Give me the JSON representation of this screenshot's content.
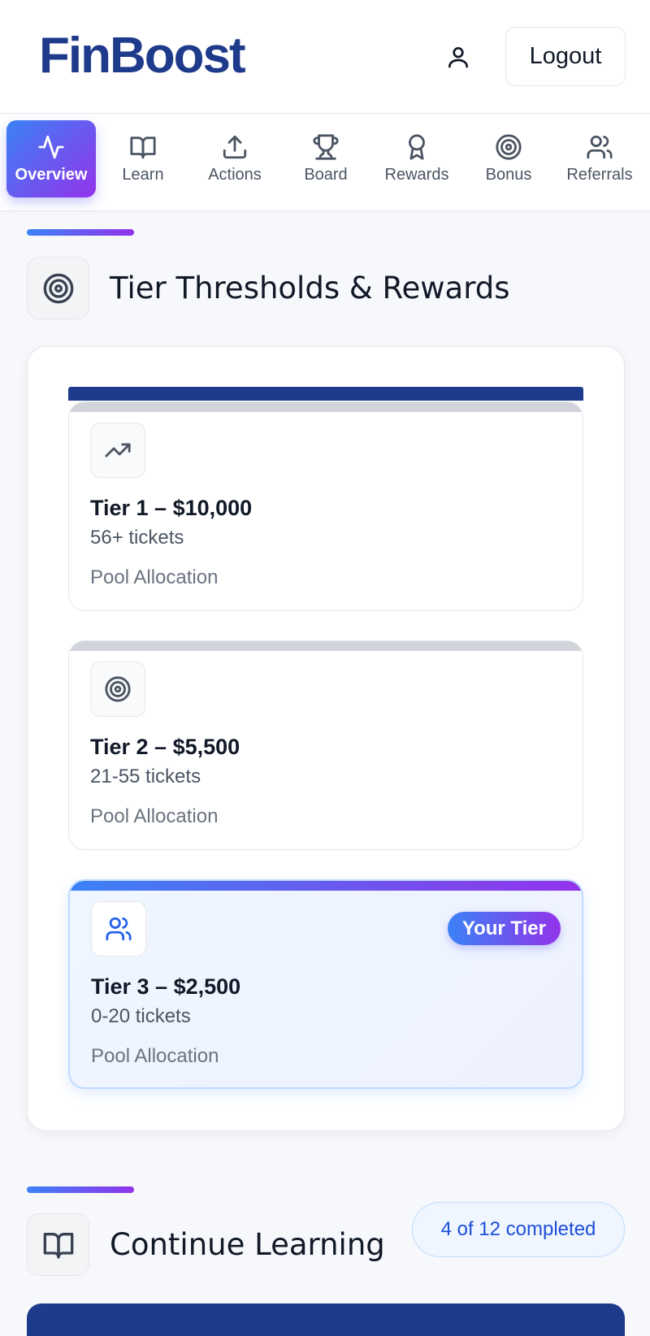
{
  "app": {
    "brand": "FinBoost",
    "logout_label": "Logout"
  },
  "nav": {
    "items": [
      {
        "label": "Overview",
        "icon": "activity-icon",
        "active": true
      },
      {
        "label": "Learn",
        "icon": "book-icon",
        "active": false
      },
      {
        "label": "Actions",
        "icon": "upload-icon",
        "active": false
      },
      {
        "label": "Board",
        "icon": "trophy-icon",
        "active": false
      },
      {
        "label": "Rewards",
        "icon": "award-icon",
        "active": false
      },
      {
        "label": "Bonus",
        "icon": "target-icon",
        "active": false
      },
      {
        "label": "Referrals",
        "icon": "users-icon",
        "active": false
      }
    ]
  },
  "tiers_section": {
    "title": "Tier Thresholds & Rewards",
    "icon": "target-icon",
    "tiers": [
      {
        "name": "Tier 1 – $10,000",
        "tickets": "56+ tickets",
        "allocation": "Pool Allocation",
        "icon": "trending-up-icon",
        "current": false
      },
      {
        "name": "Tier 2 – $5,500",
        "tickets": "21-55 tickets",
        "allocation": "Pool Allocation",
        "icon": "target-icon",
        "current": false
      },
      {
        "name": "Tier 3 – $2,500",
        "tickets": "0-20 tickets",
        "allocation": "Pool Allocation",
        "icon": "users-icon",
        "current": true,
        "badge": "Your Tier"
      }
    ]
  },
  "learning_section": {
    "title": "Continue Learning",
    "icon": "book-icon",
    "progress_label": "4 of 12 completed",
    "completed": 4,
    "total": 12
  },
  "colors": {
    "brand": "#1e3a8a",
    "accent_start": "#3b82f6",
    "accent_end": "#9333ea"
  }
}
